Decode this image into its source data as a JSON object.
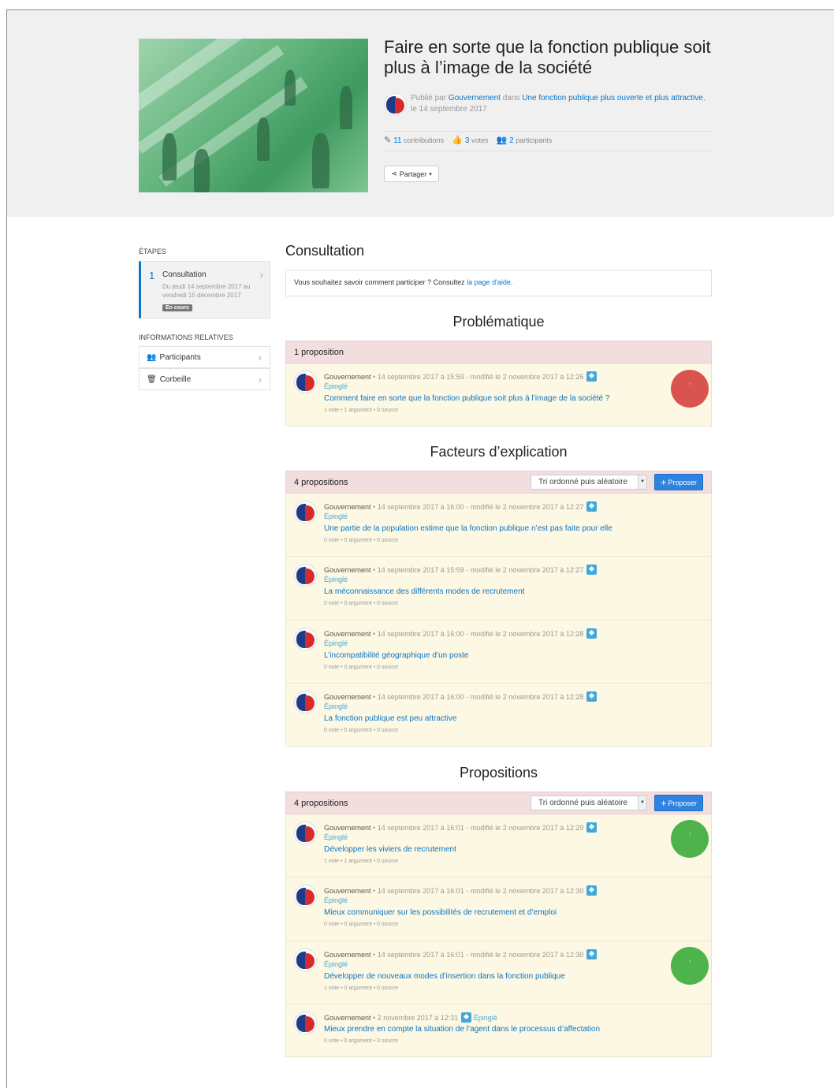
{
  "hero": {
    "title": "Faire en sorte que la fonction publique soit plus à l’image de la société",
    "published_by": "Publié par",
    "author": "Gouvernement",
    "in_label": "dans",
    "project": "Une fonction publique plus ouverte et plus attractive",
    "date": ", le 14 septembre 2017",
    "contributions_count": "11",
    "contributions_label": "contributions",
    "votes_count": "3",
    "votes_label": "votes",
    "participants_count": "2",
    "participants_label": "participants",
    "share_label": "Partager"
  },
  "sidebar": {
    "steps_heading": "ÉTAPES",
    "step": {
      "number": "1",
      "title": "Consultation",
      "dates": "Du jeudi 14 septembre 2017 au vendredi 15 décembre 2017",
      "badge": "En cours"
    },
    "related_heading": "INFORMATIONS RELATIVES",
    "items": [
      {
        "label": "Participants",
        "icon": "users-icon"
      },
      {
        "label": "Corbeille",
        "icon": "trash-icon"
      }
    ]
  },
  "main": {
    "title": "Consultation",
    "help_text": "Vous souhaitez savoir comment participer ? Consultez ",
    "help_link": "la page d'aide",
    "help_end": ".",
    "sort_label": "Tri ordonné puis aléatoire",
    "propose_label": "Proposer",
    "sections": [
      {
        "title": "Problématique",
        "count_label": "1 proposition",
        "proposals": [
          {
            "meta": " • 14 septembre 2017 à 15:59 - modifié le 2 novembre 2017 à 12:26",
            "pinned": "Épinglé",
            "title": "Comment faire en sorte que la fonction publique soit plus à l’image de la société ?",
            "stats": "1 vote • 1 argument • 0 source",
            "vote": "red"
          }
        ]
      },
      {
        "title": "Facteurs d’explication",
        "count_label": "4 propositions",
        "proposals": [
          {
            "meta": " • 14 septembre 2017 à 16:00 - modifié le 2 novembre 2017 à 12:27",
            "pinned": "Épinglé",
            "title": "Une partie de la population estime que la fonction publique n’est pas faite pour elle",
            "stats": "0 vote • 0 argument • 0 source"
          },
          {
            "meta": " • 14 septembre 2017 à 15:59 - modifié le 2 novembre 2017 à 12:27",
            "pinned": "Épinglé",
            "title": "La méconnaissance des différents modes de recrutement",
            "stats": "0 vote • 0 argument • 0 source"
          },
          {
            "meta": " • 14 septembre 2017 à 16:00 - modifié le 2 novembre 2017 à 12:28",
            "pinned": "Épinglé",
            "title": "L’incompatibilité géographique d’un poste",
            "stats": "0 vote • 0 argument • 0 source"
          },
          {
            "meta": " • 14 septembre 2017 à 16:00 - modifié le 2 novembre 2017 à 12:28",
            "pinned": "Épinglé",
            "title": "La fonction publique est peu attractive",
            "stats": "0 vote • 0 argument • 0 source"
          }
        ]
      },
      {
        "title": "Propositions",
        "count_label": "4 propositions",
        "proposals": [
          {
            "meta": " • 14 septembre 2017 à 16:01 - modifié le 2 novembre 2017 à 12:29",
            "pinned": "Épinglé",
            "title": "Développer les viviers de recrutement",
            "stats": "1 vote • 1 argument • 0 source",
            "vote": "green"
          },
          {
            "meta": " • 14 septembre 2017 à 16:01 - modifié le 2 novembre 2017 à 12:30",
            "pinned": "Épinglé",
            "title": "Mieux communiquer sur les possibilités de recrutement et d’emploi",
            "stats": "0 vote • 0 argument • 0 source"
          },
          {
            "meta": " • 14 septembre 2017 à 16:01 - modifié le 2 novembre 2017 à 12:30",
            "pinned": "Épinglé",
            "title": "Développer de nouveaux modes d’insertion dans la fonction publique",
            "stats": "1 vote • 0 argument • 0 source",
            "vote": "green"
          },
          {
            "meta": " • 2 novembre 2017 à 12:31",
            "pinned": "Épinglé",
            "title": "Mieux prendre en compte la situation de l’agent dans le processus d’affectation",
            "stats": "0 vote • 0 argument • 0 source"
          }
        ]
      }
    ],
    "author": "Gouvernement",
    "vote_dot": "↑"
  },
  "colors": {
    "link": "#0b74c4",
    "pin": "#3fa9dd",
    "header_bg": "#f2dede",
    "card_bg": "#fcf8e3",
    "vote_red": "#d9534f",
    "vote_green": "#4fb34b"
  }
}
